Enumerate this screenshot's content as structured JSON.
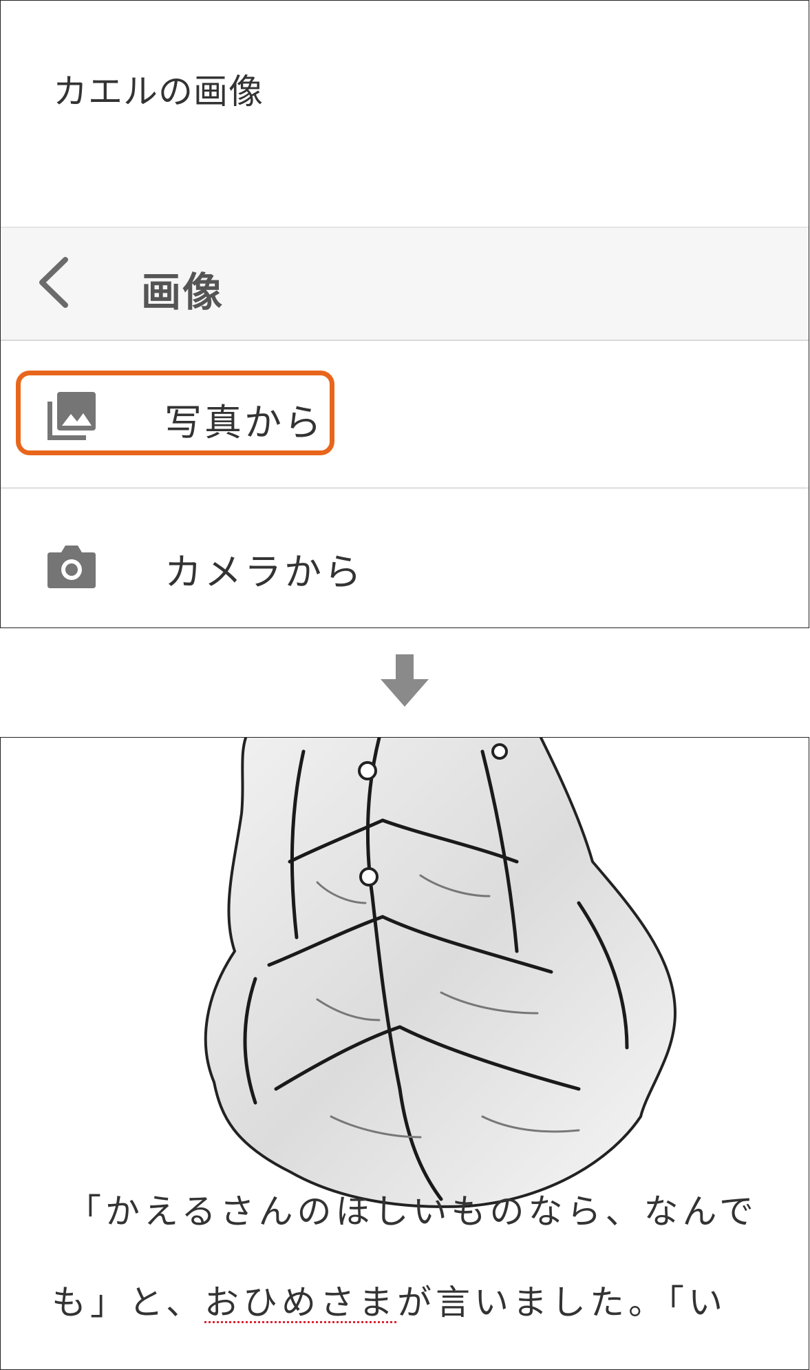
{
  "dialog": {
    "title": "カエルの画像"
  },
  "sheet": {
    "title": "画像",
    "options": [
      {
        "label": "写真から",
        "icon": "photo-library-icon"
      },
      {
        "label": "カメラから",
        "icon": "camera-icon"
      }
    ]
  },
  "colors": {
    "highlight": "#e8661c",
    "icon_gray": "#757575",
    "arrow_gray": "#8a8a8a"
  },
  "story": {
    "line1": "「かえるさんのほしいものなら、なんで",
    "line2_pre": "も」と、",
    "line2_underlined": "おひめさま",
    "line2_post": "が言いました。「い"
  }
}
